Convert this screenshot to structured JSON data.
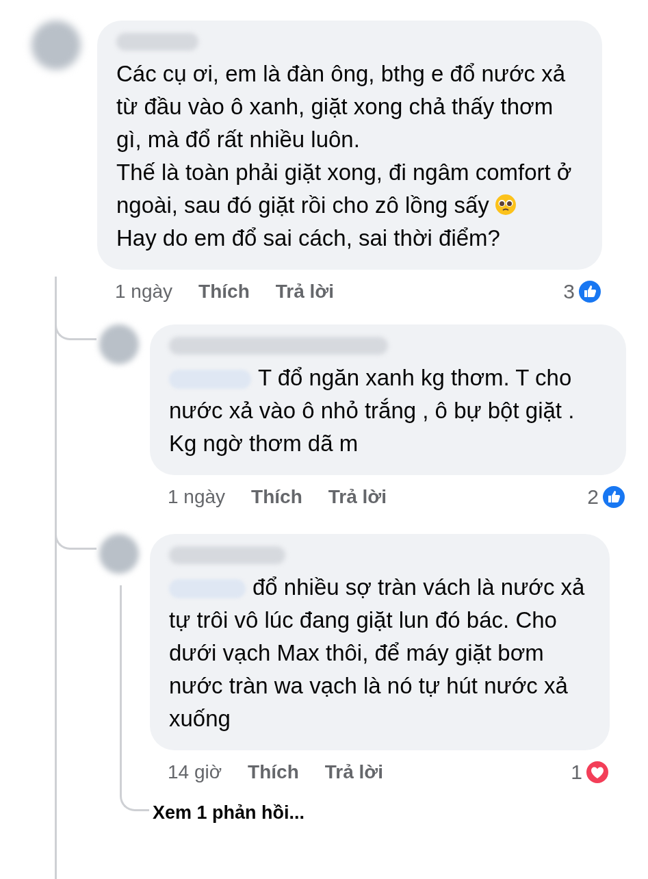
{
  "comment": {
    "author_hidden": true,
    "paragraphs": [
      {
        "text": "Các cụ ơi, em là đàn ông, bthg e đổ nước xả từ đầu vào ô xanh, giặt xong chả thấy thơm gì, mà đổ rất nhiều luôn.",
        "trailing_emoji": false
      },
      {
        "text": "Thế là toàn phải giặt xong, đi ngâm comfort ở ngoài, sau đó giặt rồi cho zô lồng sấy",
        "trailing_emoji": true
      },
      {
        "text": "Hay do em đổ sai cách, sai thời điểm?",
        "trailing_emoji": false
      }
    ],
    "time": "1 ngày",
    "like_label": "Thích",
    "reply_label": "Trả lời",
    "reaction_count": "3",
    "reaction": {
      "kind": "like"
    },
    "children": [
      {
        "author_hidden": true,
        "mention_hidden": true,
        "paragraphs": [
          {
            "text": "T đổ ngăn xanh kg thơm. T cho nước xả vào ô nhỏ trắng , ô bự bột giặt . Kg ngờ thơm dã m",
            "trailing_emoji": false
          }
        ],
        "time": "1 ngày",
        "like_label": "Thích",
        "reply_label": "Trả lời",
        "reaction_count": "2",
        "reaction": {
          "kind": "like"
        }
      },
      {
        "author_hidden": true,
        "mention_hidden": true,
        "paragraphs": [
          {
            "text": "đổ nhiều sợ tràn vách là nước xả tự trôi vô lúc đang giặt lun đó bác. Cho dưới vạch Max thôi, để máy giặt bơm nước tràn wa vạch là nó tự hút nước xả xuống",
            "trailing_emoji": false
          }
        ],
        "time": "14 giờ",
        "like_label": "Thích",
        "reply_label": "Trả lời",
        "reaction_count": "1",
        "reaction": {
          "kind": "love"
        },
        "view_replies": "Xem 1 phản hồi..."
      }
    ]
  }
}
